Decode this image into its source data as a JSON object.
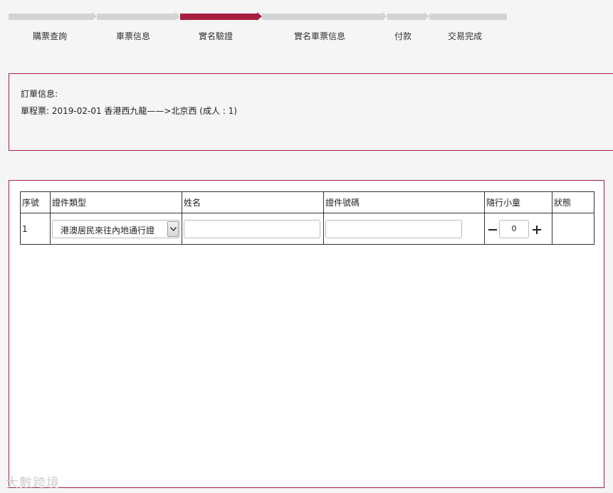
{
  "stepper": {
    "steps": [
      "購票查詢",
      "車票信息",
      "實名驗證",
      "實名車票信息",
      "付款",
      "交易完成"
    ],
    "active_step": "實名驗證",
    "colors": {
      "active": "#a81f3f",
      "inactive": "#d3d3d3"
    }
  },
  "order": {
    "title": "訂單信息:",
    "line": "單程票: 2019-02-01 香港西九龍——>北京西 (成人 : 1)"
  },
  "passengers": {
    "headers": [
      "序號",
      "證件類型",
      "姓名",
      "證件號碼",
      "隨行小童",
      "狀態"
    ],
    "rows": [
      {
        "index": "1",
        "doc_type": "港澳居民來往內地通行證",
        "name": "",
        "doc_number": "",
        "children_count": "0",
        "status": ""
      }
    ]
  },
  "watermark": "大數跨境",
  "theme": {
    "accent": "#a81f3f",
    "background": "#f5f5f5"
  }
}
